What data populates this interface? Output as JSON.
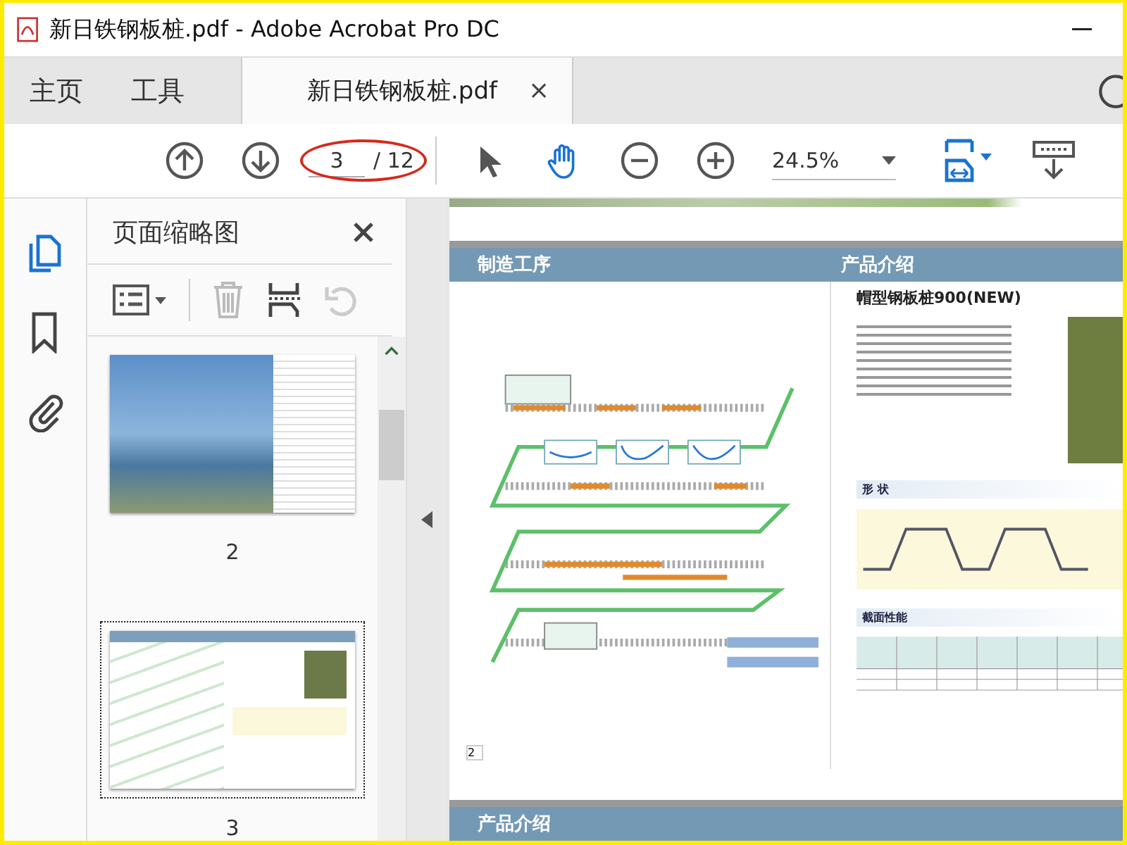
{
  "window": {
    "title": "新日铁钢板桩.pdf - Adobe Acrobat Pro DC"
  },
  "tabs": [
    {
      "label": "主页",
      "selected": false
    },
    {
      "label": "工具",
      "selected": false
    },
    {
      "label": "新日铁钢板桩.pdf",
      "selected": true,
      "close": "×"
    }
  ],
  "toolbar": {
    "page_current": "3",
    "page_total": "/ 12",
    "zoom": "24.5%",
    "tools": [
      {
        "kind": "select",
        "selected": false
      },
      {
        "kind": "hand",
        "selected": true
      }
    ]
  },
  "rail": [
    {
      "kind": "pages",
      "selected": true
    },
    {
      "kind": "bookmarks",
      "selected": false
    },
    {
      "kind": "attachments",
      "selected": false
    }
  ],
  "panel": {
    "title": "页面缩略图",
    "thumbnails": [
      {
        "label": "2",
        "kind": "cover",
        "selected": false
      },
      {
        "label": "3",
        "kind": "spread",
        "selected": true
      }
    ]
  },
  "document": {
    "left_heading": "制造工序",
    "right_heading": "产品介绍",
    "product_title": "帽型钢板桩900(NEW)",
    "sections": [
      "形 状",
      "截面性能"
    ],
    "page_number": "2",
    "next_heading": "产品介绍"
  }
}
